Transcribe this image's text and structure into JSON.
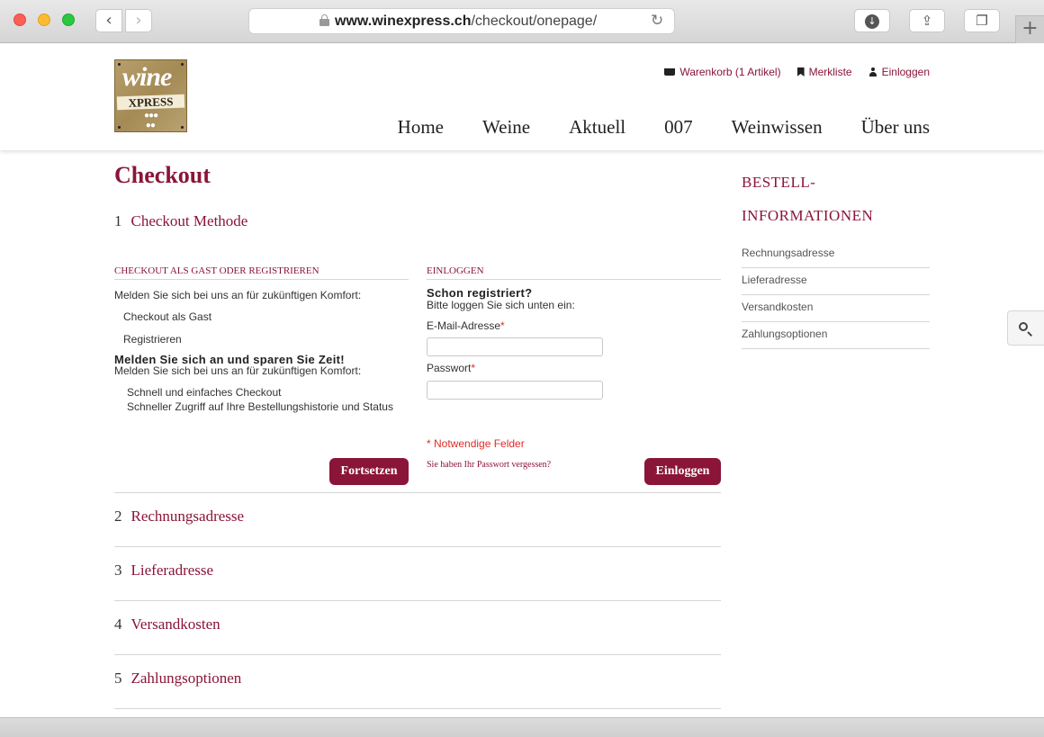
{
  "browser": {
    "url_host": "www.winexpress.ch",
    "url_path": "/checkout/onepage/"
  },
  "icons": {
    "cart": "cart-icon",
    "bookmark": "bookmark-icon",
    "user": "user-icon",
    "search": "search-icon",
    "lock": "lock-icon",
    "reload": "reload-icon"
  },
  "colors": {
    "accent": "#8a1538",
    "required": "#e02b27"
  },
  "logo": {
    "word1": "wine",
    "word2": "XPRESS"
  },
  "toplinks": {
    "cart": "Warenkorb (1 Artikel)",
    "wishlist": "Merkliste",
    "login": "Einloggen"
  },
  "nav": [
    "Home",
    "Weine",
    "Aktuell",
    "007",
    "Weinwissen",
    "Über uns"
  ],
  "checkout": {
    "title": "Checkout",
    "step1": {
      "num": "1",
      "label": "Checkout Methode"
    },
    "left": {
      "heading": "Checkout als Gast oder registrieren",
      "intro": "Melden Sie sich bei uns an für zukünftigen Komfort:",
      "opt_guest": "Checkout als Gast",
      "opt_register": "Registrieren",
      "save_title": "Melden Sie sich an und sparen Sie Zeit!",
      "save_text": "Melden Sie sich bei uns an für zukünftigen Komfort:",
      "bullet1": "Schnell und einfaches Checkout",
      "bullet2": "Schneller Zugriff auf Ihre Bestellungshistorie und Status",
      "continue_label": "Fortsetzen"
    },
    "right": {
      "heading": "Einloggen",
      "already": "Schon registriert?",
      "below": "Bitte loggen Sie sich unten ein:",
      "email_label": "E-Mail-Adresse",
      "password_label": "Passwort",
      "required_mark": "*",
      "required_note": "* Notwendige Felder",
      "forgot": "Sie haben Ihr Passwort vergessen?",
      "login_label": "Einloggen",
      "email_value": "",
      "password_value": ""
    },
    "steps": [
      {
        "num": "2",
        "label": "Rechnungsadresse"
      },
      {
        "num": "3",
        "label": "Lieferadresse"
      },
      {
        "num": "4",
        "label": "Versandkosten"
      },
      {
        "num": "5",
        "label": "Zahlungsoptionen"
      }
    ]
  },
  "sidebar": {
    "title_line1": "BESTELL-",
    "title_line2": "INFORMATIONEN",
    "items": [
      "Rechnungsadresse",
      "Lieferadresse",
      "Versandkosten",
      "Zahlungsoptionen"
    ]
  }
}
